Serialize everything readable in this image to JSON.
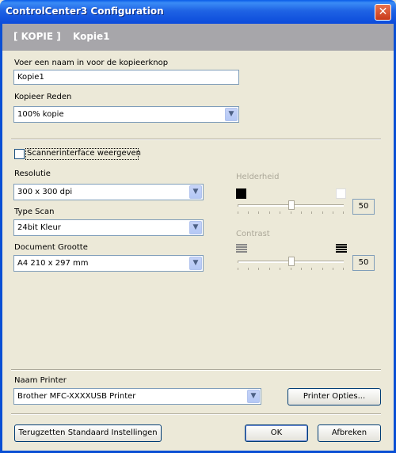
{
  "window": {
    "title": "ControlCenter3 Configuration",
    "close_glyph": "✕"
  },
  "header": {
    "tab_label": "[ KOPIE ]",
    "name": "Kopie1"
  },
  "name_field": {
    "label": "Voer een naam in voor de kopieerknop",
    "value": "Kopie1"
  },
  "copy_ratio": {
    "label": "Kopieer Reden",
    "value": "100% kopie"
  },
  "scanner_ui": {
    "label": "Scannerinterface weergeven",
    "checked": false
  },
  "resolution": {
    "label": "Resolutie",
    "value": "300 x 300 dpi"
  },
  "scan_type": {
    "label": "Type Scan",
    "value": "24bit Kleur"
  },
  "doc_size": {
    "label": "Document Grootte",
    "value": "A4 210 x 297 mm"
  },
  "brightness": {
    "label": "Helderheid",
    "value": "50"
  },
  "contrast": {
    "label": "Contrast",
    "value": "50"
  },
  "printer": {
    "label": "Naam Printer",
    "value": "Brother MFC-XXXXUSB Printer",
    "options_button": "Printer Opties..."
  },
  "footer": {
    "reset_button": "Terugzetten Standaard Instellingen",
    "ok_button": "OK",
    "cancel_button": "Afbreken"
  },
  "icons": {
    "dropdown": "chevron-down-icon"
  },
  "colors": {
    "title_bar": "#1f63e4",
    "header_band": "#a7a6aa",
    "dialog_bg": "#ece9d8",
    "close_button": "#c8391a"
  }
}
